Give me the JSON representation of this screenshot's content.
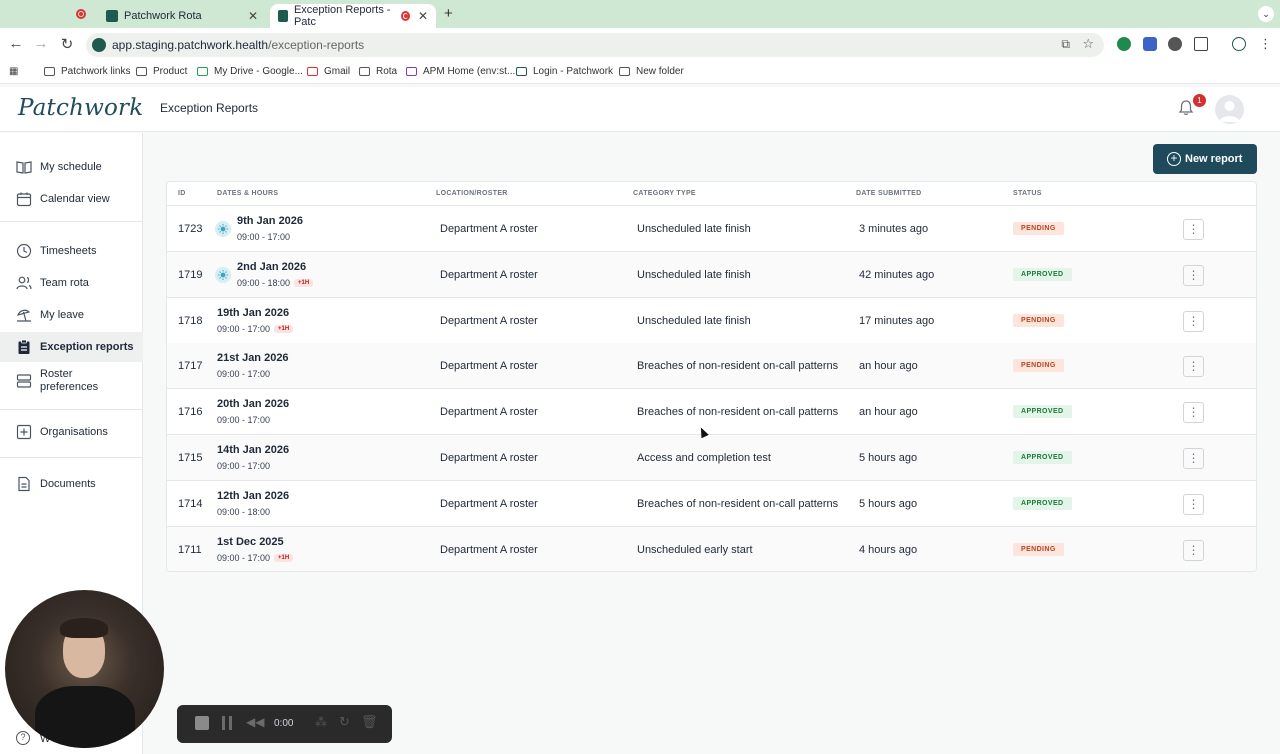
{
  "browser": {
    "tabs": [
      {
        "title": "Patchwork Rota",
        "active": false
      },
      {
        "title": "Exception Reports - Patc",
        "active": true
      }
    ],
    "url_host": "app.staging.patchwork.health",
    "url_path": "/exception-reports",
    "bookmarks": [
      "Patchwork links",
      "Product",
      "My Drive - Google...",
      "Gmail",
      "Rota",
      "APM Home (env:st...",
      "Login - Patchwork",
      "New folder"
    ]
  },
  "header": {
    "logo": "Patchwork",
    "title": "Exception Reports",
    "notification_count": "1"
  },
  "sidebar": {
    "items": [
      {
        "label": "My schedule",
        "icon": "book-icon"
      },
      {
        "label": "Calendar view",
        "icon": "calendar-icon"
      },
      {
        "label": "Timesheets",
        "icon": "clock-icon"
      },
      {
        "label": "Team rota",
        "icon": "users-icon"
      },
      {
        "label": "My leave",
        "icon": "beach-icon"
      },
      {
        "label": "Exception reports",
        "icon": "clipboard-icon",
        "active": true
      },
      {
        "label": "Roster preferences",
        "icon": "layers-icon"
      },
      {
        "label": "Organisations",
        "icon": "plus-square-icon"
      },
      {
        "label": "Documents",
        "icon": "document-icon"
      }
    ],
    "help_label": "W"
  },
  "main": {
    "new_report_label": "New report",
    "columns": [
      "ID",
      "DATES & HOURS",
      "LOCATION/ROSTER",
      "CATEGORY TYPE",
      "DATE SUBMITTED",
      "STATUS"
    ],
    "rows": [
      {
        "id": "1723",
        "date": "9th Jan 2026",
        "hours": "09:00 - 17:00",
        "extra": "",
        "day_icon": true,
        "location": "Department A roster",
        "category": "Unscheduled late finish",
        "submitted": "3 minutes ago",
        "status": "PENDING"
      },
      {
        "id": "1719",
        "date": "2nd Jan 2026",
        "hours": "09:00 - 18:00",
        "extra": "+1H",
        "day_icon": true,
        "location": "Department A roster",
        "category": "Unscheduled late finish",
        "submitted": "42 minutes ago",
        "status": "APPROVED"
      },
      {
        "id": "1718",
        "date": "19th Jan 2026",
        "hours": "09:00 - 17:00",
        "extra": "+1H",
        "day_icon": false,
        "location": "Department A roster",
        "category": "Unscheduled late finish",
        "submitted": "17 minutes ago",
        "status": "PENDING"
      },
      {
        "id": "1717",
        "date": "21st Jan 2026",
        "hours": "09:00 - 17:00",
        "extra": "",
        "day_icon": false,
        "location": "Department A roster",
        "category": "Breaches of non-resident on-call patterns",
        "submitted": "an hour ago",
        "status": "PENDING"
      },
      {
        "id": "1716",
        "date": "20th Jan 2026",
        "hours": "09:00 - 17:00",
        "extra": "",
        "day_icon": false,
        "location": "Department A roster",
        "category": "Breaches of non-resident on-call patterns",
        "submitted": "an hour ago",
        "status": "APPROVED"
      },
      {
        "id": "1715",
        "date": "14th Jan 2026",
        "hours": "09:00 - 17:00",
        "extra": "",
        "day_icon": false,
        "location": "Department A roster",
        "category": "Access and completion test",
        "submitted": "5 hours ago",
        "status": "APPROVED"
      },
      {
        "id": "1714",
        "date": "12th Jan 2026",
        "hours": "09:00 - 18:00",
        "extra": "",
        "day_icon": false,
        "location": "Department A roster",
        "category": "Breaches of non-resident on-call patterns",
        "submitted": "5 hours ago",
        "status": "APPROVED"
      },
      {
        "id": "1711",
        "date": "1st Dec 2025",
        "hours": "09:00 - 17:00",
        "extra": "+1H",
        "day_icon": false,
        "location": "Department A roster",
        "category": "Unscheduled early start",
        "submitted": "4 hours ago",
        "status": "PENDING"
      }
    ]
  },
  "recorder": {
    "time": "0:00"
  },
  "colors": {
    "brand": "#1e4a5c",
    "pending_bg": "#fde4dc",
    "approved_bg": "#e3f4e8"
  }
}
